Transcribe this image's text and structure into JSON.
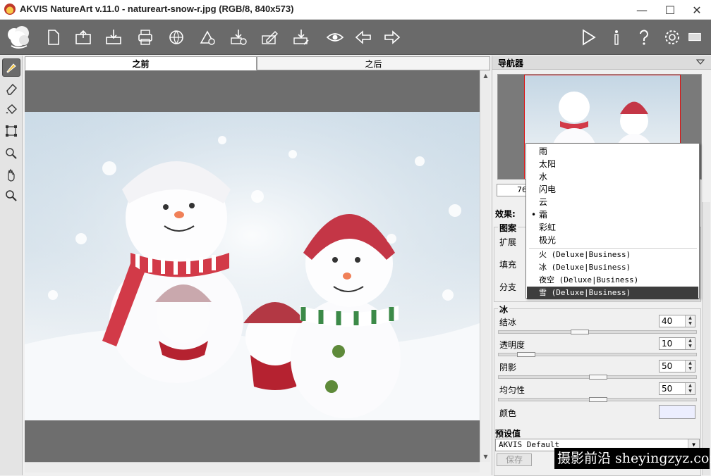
{
  "window": {
    "title": "AKVIS NatureArt v.11.0 - natureart-snow-r.jpg (RGB/8, 840x573)",
    "minimize_glyph": "—",
    "maximize_glyph": "☐",
    "close_glyph": "✕"
  },
  "toolbar": {
    "icons": [
      "app-logo-icon",
      "new-file-icon",
      "open-file-icon",
      "save-file-icon",
      "print-icon",
      "share-web-icon",
      "batch-settings-icon",
      "download-settings-icon",
      "edit-icon",
      "plugin-icon",
      "preview-eye-icon",
      "back-arrow-icon",
      "forward-arrow-icon",
      "run-icon",
      "info-icon",
      "help-icon",
      "settings-gear-icon",
      "message-icon"
    ]
  },
  "tools": [
    "brush-icon",
    "eraser-icon",
    "bucket-icon",
    "transform-icon",
    "hand-stamp-icon",
    "hand-icon",
    "zoom-icon"
  ],
  "tabs": {
    "before": "之前",
    "after": "之后"
  },
  "navigator": {
    "title": "导航器",
    "zoom": "76."
  },
  "effect": {
    "label": "效果:",
    "pattern_group": "图案",
    "expand_label": "扩展",
    "fill_label": "填充",
    "branch_label": "分支"
  },
  "ice": {
    "group": "冰",
    "freeze_label": "结冰",
    "freeze_value": "40",
    "transparency_label": "透明度",
    "transparency_value": "10",
    "shadow_label": "阴影",
    "shadow_value": "50",
    "uniformity_label": "均匀性",
    "uniformity_value": "50",
    "color_label": "颜色",
    "color_value": "#eceefe"
  },
  "presets": {
    "title": "预设值",
    "selected": "AKVIS Default",
    "save_label": "保存"
  },
  "popup": {
    "items": [
      {
        "label": "雨",
        "selected": false,
        "highlight": false
      },
      {
        "label": "太阳",
        "selected": false,
        "highlight": false
      },
      {
        "label": "水",
        "selected": false,
        "highlight": false
      },
      {
        "label": "闪电",
        "selected": false,
        "highlight": false
      },
      {
        "label": "云",
        "selected": false,
        "highlight": false
      },
      {
        "label": "霜",
        "selected": true,
        "highlight": false
      },
      {
        "label": "彩虹",
        "selected": false,
        "highlight": false
      },
      {
        "label": "极光",
        "selected": false,
        "highlight": false
      },
      {
        "label": "火 (Deluxe|Business)",
        "selected": false,
        "highlight": false
      },
      {
        "label": "冰 (Deluxe|Business)",
        "selected": false,
        "highlight": false
      },
      {
        "label": "夜空 (Deluxe|Business)",
        "selected": false,
        "highlight": false
      },
      {
        "label": "雪 (Deluxe|Business)",
        "selected": false,
        "highlight": true
      }
    ],
    "selected_marker": "•"
  },
  "watermark": "摄影前沿 sheyingzyz.com",
  "colors": {
    "toolbar_bg": "#6a6a6a",
    "highlight": "#3d3d3d",
    "nav_border": "#dd1111"
  }
}
